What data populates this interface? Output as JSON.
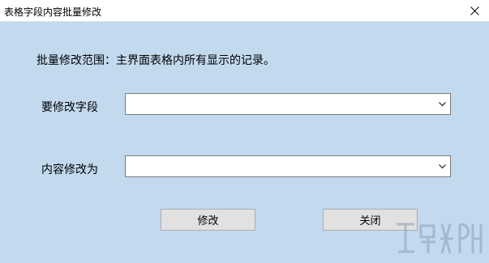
{
  "window": {
    "title": "表格字段内容批量修改",
    "close_glyph": "✕"
  },
  "main": {
    "scope_text": "批量修改范围：主界面表格内所有显示的记录。",
    "field_label": "要修改字段",
    "field_value": "",
    "content_label": "内容修改为",
    "content_value": "",
    "modify_button": "修改",
    "close_button": "关闭"
  },
  "colors": {
    "client_bg": "#c2d9ee",
    "button_bg": "#e1e1e1",
    "combo_border": "#7a7a7a"
  },
  "icons": {
    "close": "close-icon",
    "dropdown": "chevron-down-icon",
    "watermark": "site-logo-watermark"
  }
}
